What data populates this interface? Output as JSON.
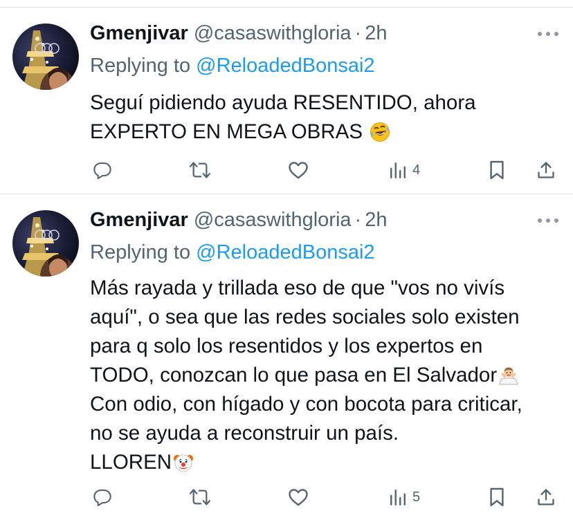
{
  "tweets": [
    {
      "author_name": "Gmenjivar",
      "handle": "@casaswithgloria",
      "separator": "·",
      "time": "2h",
      "replying_prefix": "Replying to",
      "replying_to": "@ReloadedBonsai2",
      "text_lines": [
        "Seguí pidiendo ayuda RESENTIDO,  ahora",
        "EXPERTO EN MEGA OBRAS"
      ],
      "emojis": [
        "rolling-on-floor-laughing"
      ],
      "views_count": "4"
    },
    {
      "author_name": "Gmenjivar",
      "handle": "@casaswithgloria",
      "separator": "·",
      "time": "2h",
      "replying_prefix": "Replying to",
      "replying_to": "@ReloadedBonsai2",
      "text_lines": [
        "Más rayada y trillada eso de que \"vos no vivís",
        "aquí\", o sea que las redes sociales solo existen",
        "para q solo los  resentidos y los expertos en",
        "TODO, conozcan lo que pasa en El Salvador",
        "Con odio, con hígado y con bocota para criticar,",
        "no se ayuda a reconstruir un país.",
        "LLOREN"
      ],
      "emojis": [
        "person-shrugging",
        "clown-face"
      ],
      "views_count": "5"
    }
  ],
  "icons": [
    "more-icon",
    "reply-icon",
    "retweet-icon",
    "like-icon",
    "views-icon",
    "bookmark-icon",
    "share-icon"
  ],
  "colors": {
    "text": "#0f1419",
    "secondary": "#536471",
    "link": "#1d9bf0",
    "separator": "#dfe3e6"
  }
}
